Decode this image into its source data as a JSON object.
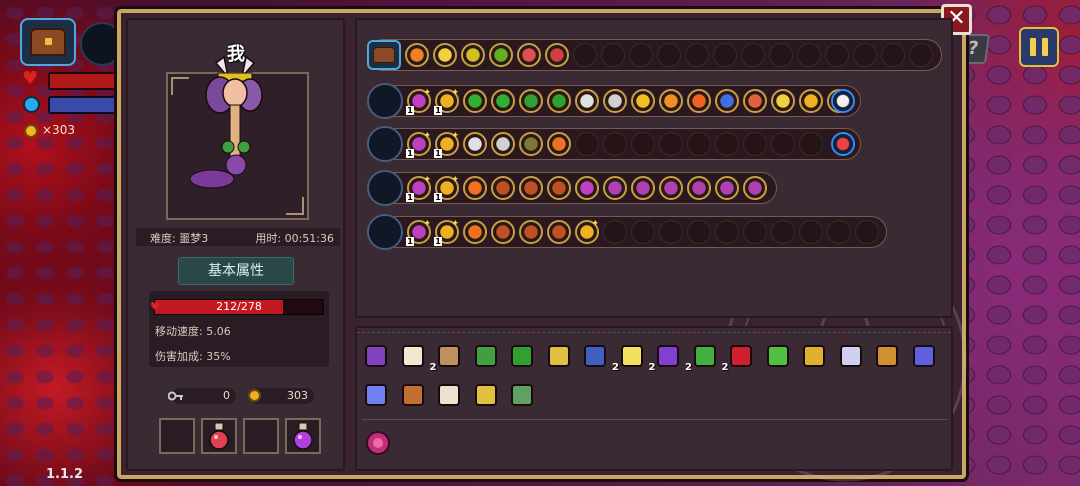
{
  "hud": {
    "coins": "×303",
    "version": "1.1.2",
    "help_glyph": "?"
  },
  "panel": {
    "close_glyph": "✕",
    "character": {
      "me_label": "我",
      "difficulty": "难度: 噩梦3",
      "time": "用时: 00:51:36",
      "attr_tab": "基本属性",
      "hp_text": "212/278",
      "hp_fraction": 0.7626,
      "move_speed": "移动速度: 5.06",
      "damage_bonus": "伤害加成: 35%",
      "keys": "0",
      "coins": "303"
    },
    "potion_slots": [
      {
        "name": "empty-slot",
        "filled": false
      },
      {
        "name": "red-potion",
        "filled": true,
        "color": "#e04050"
      },
      {
        "name": "empty-slot",
        "filled": false
      },
      {
        "name": "purple-potion",
        "filled": true,
        "color": "#b040e0"
      }
    ],
    "weapon_rows": [
      {
        "head": "chest",
        "slots": [
          {
            "c": "#f08020"
          },
          {
            "c": "#f0d040"
          },
          {
            "c": "#d0c020"
          },
          {
            "c": "#60b020"
          },
          {
            "c": "#e05050"
          },
          {
            "c": "#d04040"
          },
          null,
          null,
          null,
          null,
          null,
          null,
          null,
          null,
          null,
          null,
          null,
          null,
          null
        ],
        "end_slot": null
      },
      {
        "head": "weapon",
        "slots": [
          {
            "c": "#c040c0",
            "lvl": "1",
            "plus": true
          },
          {
            "c": "#f0b020",
            "lvl": "1",
            "plus": true
          },
          {
            "c": "#30b030"
          },
          {
            "c": "#30b030"
          },
          {
            "c": "#30a030"
          },
          {
            "c": "#30a030"
          },
          {
            "c": "#e0e0e0"
          },
          {
            "c": "#d0d0d0"
          },
          {
            "c": "#f0c020"
          },
          {
            "c": "#f09020"
          },
          {
            "c": "#f06020"
          },
          {
            "c": "#4070e0"
          },
          {
            "c": "#e06040"
          },
          {
            "c": "#f0d040"
          },
          {
            "c": "#f0b020"
          },
          {
            "c": "#e0e0ff"
          }
        ],
        "end_slot": {
          "c": "#f0f0f0",
          "ring": "blue"
        }
      },
      {
        "head": "weapon",
        "slots": [
          {
            "c": "#c040c0",
            "lvl": "1",
            "plus": true
          },
          {
            "c": "#f0b020",
            "lvl": "1",
            "plus": true
          },
          {
            "c": "#e0e0e0"
          },
          {
            "c": "#d0d0d0"
          },
          {
            "c": "#7a7a30"
          },
          {
            "c": "#f07020"
          },
          null,
          null,
          null,
          null,
          null,
          null,
          null,
          null,
          null
        ],
        "end_slot": {
          "c": "#f04040",
          "ring": "blue"
        }
      },
      {
        "head": "weapon",
        "slots": [
          {
            "c": "#c040c0",
            "lvl": "1",
            "plus": true
          },
          {
            "c": "#f0b020",
            "lvl": "1",
            "plus": true
          },
          {
            "c": "#f07020"
          },
          {
            "c": "#c05020"
          },
          {
            "c": "#c05020"
          },
          {
            "c": "#c05020"
          },
          {
            "c": "#c040c0"
          },
          {
            "c": "#b040b0"
          },
          {
            "c": "#b040b0"
          },
          {
            "c": "#b040b0"
          },
          {
            "c": "#b040b0"
          },
          {
            "c": "#b040b0"
          },
          {
            "c": "#b040b0"
          }
        ],
        "end_slot": null
      },
      {
        "head": "weapon",
        "slots": [
          {
            "c": "#c040c0",
            "lvl": "1",
            "plus": true
          },
          {
            "c": "#f0b020",
            "lvl": "1",
            "plus": true
          },
          {
            "c": "#f07020"
          },
          {
            "c": "#c05020"
          },
          {
            "c": "#c05020"
          },
          {
            "c": "#c05020"
          },
          {
            "c": "#f0b020",
            "plus": true
          },
          null,
          null,
          null,
          null,
          null,
          null,
          null,
          null,
          null,
          null
        ],
        "end_slot": null
      }
    ],
    "items": [
      {
        "name": "hair-item",
        "c": "#8040c0",
        "count": ""
      },
      {
        "name": "fangs-item",
        "c": "#f0e8d0",
        "count": "2"
      },
      {
        "name": "scroll-item",
        "c": "#c09060",
        "count": ""
      },
      {
        "name": "boot-item",
        "c": "#40a040",
        "count": ""
      },
      {
        "name": "glove-item",
        "c": "#30a030",
        "count": ""
      },
      {
        "name": "gem-item",
        "c": "#e0c040",
        "count": ""
      },
      {
        "name": "armor-item",
        "c": "#4060c0",
        "count": "2"
      },
      {
        "name": "horn-item",
        "c": "#f0e060",
        "count": "2"
      },
      {
        "name": "witch-hat-item",
        "c": "#8040d0",
        "count": "2"
      },
      {
        "name": "leaf-item",
        "c": "#40b040",
        "count": "2"
      },
      {
        "name": "rose-item",
        "c": "#d02030",
        "count": ""
      },
      {
        "name": "sprout-item",
        "c": "#50c040",
        "count": ""
      },
      {
        "name": "chalice-item",
        "c": "#e0b030",
        "count": ""
      },
      {
        "name": "compass-item",
        "c": "#d0d0f0",
        "count": ""
      },
      {
        "name": "hourglass-item",
        "c": "#d09030",
        "count": ""
      },
      {
        "name": "potion-item",
        "c": "#6060e0",
        "count": ""
      },
      {
        "name": "crystal-item",
        "c": "#7080f0",
        "count": ""
      },
      {
        "name": "barrel-item",
        "c": "#c07030",
        "count": ""
      },
      {
        "name": "feather-item",
        "c": "#f0e0d0",
        "count": ""
      },
      {
        "name": "chain-item",
        "c": "#e0c040",
        "count": ""
      },
      {
        "name": "shoe-item",
        "c": "#60a060",
        "count": ""
      }
    ]
  }
}
